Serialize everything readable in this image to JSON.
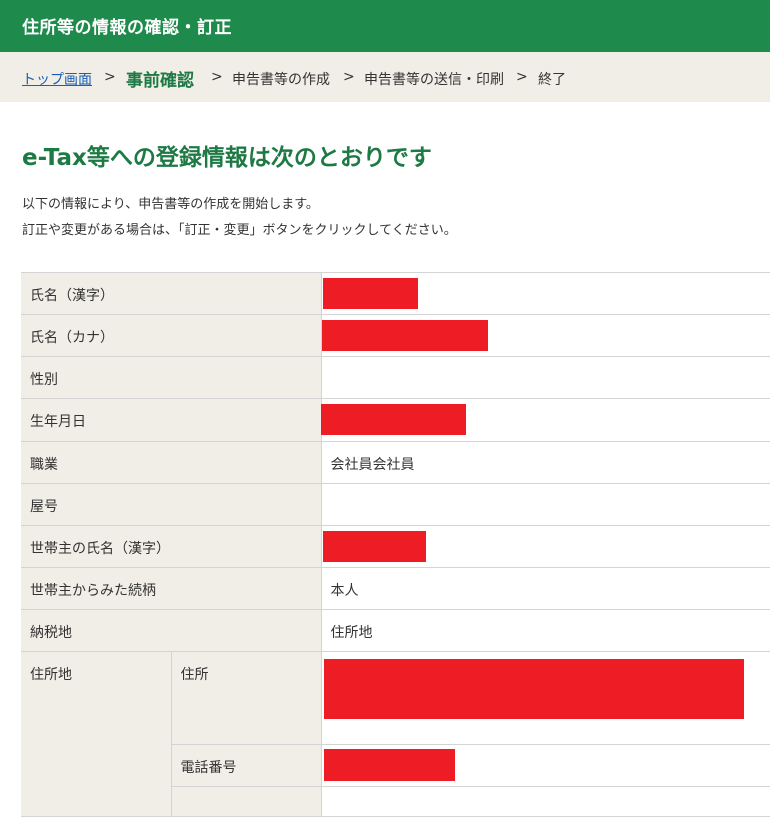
{
  "header": {
    "title": "住所等の情報の確認・訂正"
  },
  "breadcrumb": {
    "items": [
      "トップ画面",
      "事前確認",
      "申告書等の作成",
      "申告書等の送信・印刷",
      "終了"
    ],
    "separator": ">",
    "current_index": 1
  },
  "main": {
    "title": "e-Tax等への登録情報は次のとおりです",
    "intro_lines": [
      "以下の情報により、申告書等の作成を開始します。",
      "訂正や変更がある場合は、「訂正・変更」ボタンをクリックしてください。"
    ]
  },
  "table": {
    "rows": [
      {
        "label": "氏名（漢字）",
        "value": "",
        "redacted": true
      },
      {
        "label": "氏名（カナ）",
        "value": "",
        "redacted": true
      },
      {
        "label": "性別",
        "value": "",
        "redacted": false
      },
      {
        "label": "生年月日",
        "value": "",
        "redacted": true
      },
      {
        "label": "職業",
        "value": "会社員会社員",
        "redacted": false
      },
      {
        "label": "屋号",
        "value": "",
        "redacted": false
      },
      {
        "label": "世帯主の氏名（漢字）",
        "value": "",
        "redacted": true
      },
      {
        "label": "世帯主からみた続柄",
        "value": "本人",
        "redacted": false
      },
      {
        "label": "納税地",
        "value": "住所地",
        "redacted": false
      }
    ],
    "address_group": {
      "label": "住所地",
      "sub_rows": [
        {
          "label": "住所",
          "value": "",
          "redacted": true
        },
        {
          "label": "電話番号",
          "value": "",
          "redacted": true
        }
      ]
    }
  },
  "colors": {
    "header_bg": "#1e8a4c",
    "title_green": "#1e7a44",
    "label_bg": "#f0eee6",
    "redaction": "#ee1c25",
    "link": "#1a5fb4"
  }
}
